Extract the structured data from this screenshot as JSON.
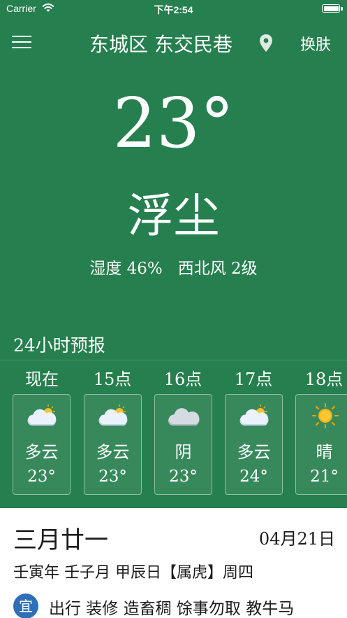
{
  "status_bar": {
    "carrier": "Carrier",
    "time": "下午2:54"
  },
  "header": {
    "location": "东城区 东交民巷",
    "skin_button": "换肤"
  },
  "current": {
    "temperature": "23°",
    "condition": "浮尘",
    "detail": "湿度 46%   西北风 2级"
  },
  "forecast": {
    "title": "24小时预报",
    "hours": [
      {
        "label": "现在",
        "condition": "多云",
        "temp": "23°",
        "icon": "partly-cloudy-icon"
      },
      {
        "label": "15点",
        "condition": "多云",
        "temp": "23°",
        "icon": "partly-cloudy-icon"
      },
      {
        "label": "16点",
        "condition": "阴",
        "temp": "23°",
        "icon": "overcast-icon"
      },
      {
        "label": "17点",
        "condition": "多云",
        "temp": "24°",
        "icon": "partly-cloudy-icon"
      },
      {
        "label": "18点",
        "condition": "晴",
        "temp": "21°",
        "icon": "sunny-icon"
      }
    ]
  },
  "calendar": {
    "lunar_date": "三月廿一",
    "solar_date": "04月21日",
    "ganzhi": "壬寅年 壬子月 甲辰日【属虎】周四",
    "yi_label": "宜",
    "yi_items": "出行 装修 造畜稠 馀事勿取 教牛马"
  },
  "colors": {
    "background": "#267f4e",
    "yi_badge": "#2f6fb7"
  }
}
